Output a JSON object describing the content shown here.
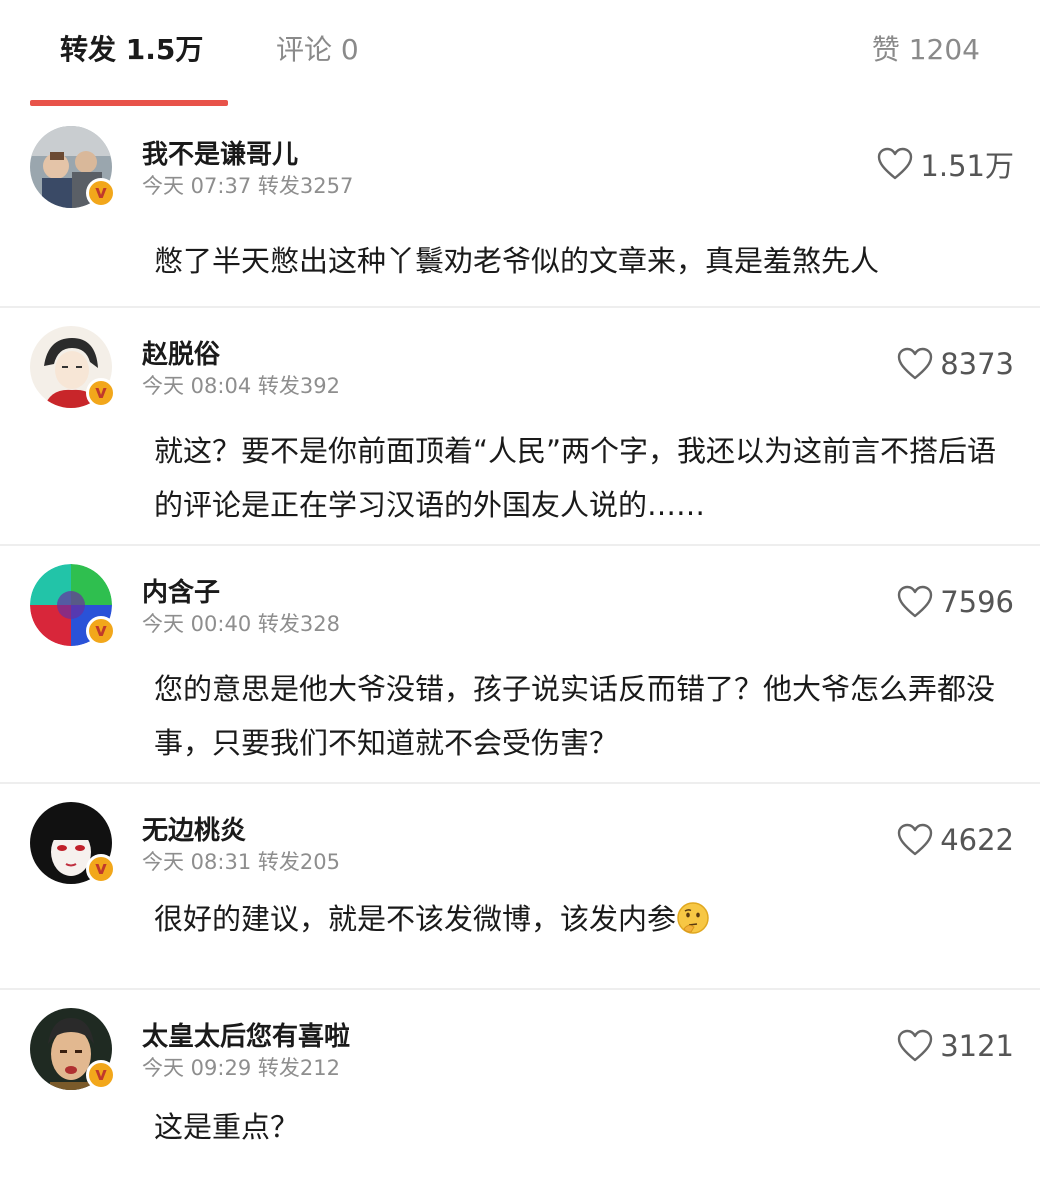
{
  "tabs": {
    "repost": "转发 1.5万",
    "comment": "评论 0",
    "likes": "赞 1204"
  },
  "colors": {
    "accent": "#e8534a",
    "badge": "#f2a71b",
    "meta_text": "#8e8e8e"
  },
  "icons": {
    "like": "heart-outline-icon",
    "verified": "verified-v-badge-icon",
    "emoji": "thinking-face-emoji-icon"
  },
  "reposts": [
    {
      "username": "我不是谦哥儿",
      "meta": "今天 07:37 转发3257",
      "likes": "1.51万",
      "text": "憋了半天憋出这种丫鬟劝老爷似的文章来，真是羞煞先人"
    },
    {
      "username": "赵脱俗",
      "meta": "今天 08:04 转发392",
      "likes": "8373",
      "text": "就这？要不是你前面顶着“人民”两个字，我还以为这前言不搭后语的评论是正在学习汉语的外国友人说的……"
    },
    {
      "username": "内含子",
      "meta": "今天 00:40 转发328",
      "likes": "7596",
      "text": "您的意思是他大爷没错，孩子说实话反而错了？他大爷怎么弄都没事，只要我们不知道就不会受伤害？"
    },
    {
      "username": "无边桃炎",
      "meta": "今天 08:31 转发205",
      "likes": "4622",
      "text": "很好的建议，就是不该发微博，该发内参"
    },
    {
      "username": "太皇太后您有喜啦",
      "meta": "今天 09:29 转发212",
      "likes": "3121",
      "text": "这是重点？"
    }
  ]
}
